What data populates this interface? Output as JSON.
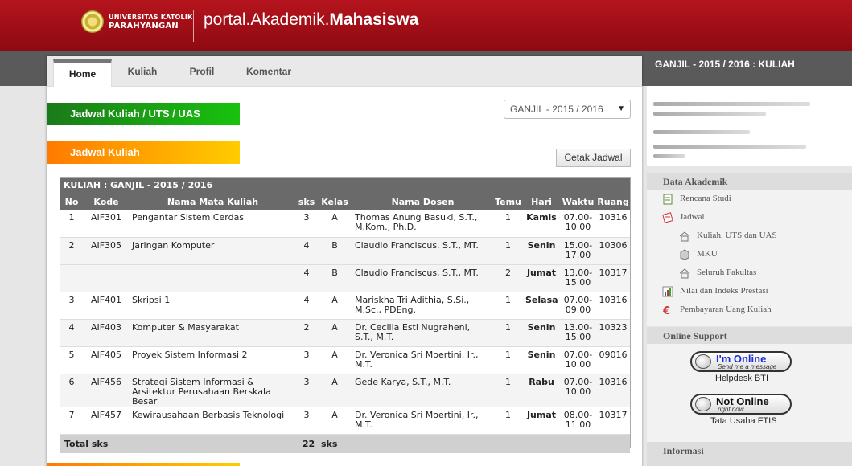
{
  "header": {
    "university_line1": "UNIVERSITAS KATOLIK",
    "university_line2": "PARAHYANGAN",
    "portal_prefix": "portal.Akademik.",
    "portal_suffix": "Mahasiswa"
  },
  "band": {
    "right_text": "GANJIL - 2015 / 2016 : KULIAH"
  },
  "tabs": [
    {
      "label": "Home",
      "active": true
    },
    {
      "label": "Kuliah",
      "active": false
    },
    {
      "label": "Profil",
      "active": false
    },
    {
      "label": "Komentar",
      "active": false
    }
  ],
  "section_titles": {
    "green": "Jadwal Kuliah / UTS / UAS",
    "orange": "Jadwal Kuliah"
  },
  "semester_select": {
    "value": "GANJIL - 2015 / 2016"
  },
  "cetak_button": "Cetak Jadwal",
  "table": {
    "caption": "KULIAH : GANJIL - 2015 / 2016",
    "headers": [
      "No",
      "Kode",
      "Nama Mata Kuliah",
      "sks",
      "Kelas",
      "Nama Dosen",
      "Temu",
      "Hari",
      "Waktu",
      "Ruang"
    ],
    "rows": [
      {
        "no": "1",
        "kode": "AIF301",
        "nama": "Pengantar Sistem Cerdas",
        "sks": "3",
        "kelas": "A",
        "dosen": "Thomas Anung Basuki, S.T., M.Kom., Ph.D.",
        "temu": "1",
        "hari": "Kamis",
        "waktu": "07.00-10.00",
        "ruang": "10316"
      },
      {
        "no": "2",
        "kode": "AIF305",
        "nama": "Jaringan Komputer",
        "sks": "4",
        "kelas": "B",
        "dosen": "Claudio Franciscus, S.T., MT.",
        "temu": "1",
        "hari": "Senin",
        "waktu": "15.00-17.00",
        "ruang": "10306"
      },
      {
        "no": "",
        "kode": "",
        "nama": "",
        "sks": "4",
        "kelas": "B",
        "dosen": "Claudio Franciscus, S.T., MT.",
        "temu": "2",
        "hari": "Jumat",
        "waktu": "13.00-15.00",
        "ruang": "10317"
      },
      {
        "no": "3",
        "kode": "AIF401",
        "nama": "Skripsi 1",
        "sks": "4",
        "kelas": "A",
        "dosen": "Mariskha Tri Adithia, S.Si., M.Sc., PDEng.",
        "temu": "1",
        "hari": "Selasa",
        "waktu": "07.00-09.00",
        "ruang": "10316"
      },
      {
        "no": "4",
        "kode": "AIF403",
        "nama": "Komputer & Masyarakat",
        "sks": "2",
        "kelas": "A",
        "dosen": "Dr. Cecilia Esti Nugraheni, S.T., M.T.",
        "temu": "1",
        "hari": "Senin",
        "waktu": "13.00-15.00",
        "ruang": "10323"
      },
      {
        "no": "5",
        "kode": "AIF405",
        "nama": "Proyek Sistem Informasi 2",
        "sks": "3",
        "kelas": "A",
        "dosen": "Dr. Veronica Sri Moertini, Ir., M.T.",
        "temu": "1",
        "hari": "Senin",
        "waktu": "07.00-10.00",
        "ruang": "09016"
      },
      {
        "no": "6",
        "kode": "AIF456",
        "nama": "Strategi Sistem Informasi & Arsitektur Perusahaan Berskala Besar",
        "sks": "3",
        "kelas": "A",
        "dosen": "Gede Karya, S.T., M.T.",
        "temu": "1",
        "hari": "Rabu",
        "waktu": "07.00-10.00",
        "ruang": "10316"
      },
      {
        "no": "7",
        "kode": "AIF457",
        "nama": "Kewirausahaan Berbasis Teknologi",
        "sks": "3",
        "kelas": "A",
        "dosen": "Dr. Veronica Sri Moertini, Ir., M.T.",
        "temu": "1",
        "hari": "Jumat",
        "waktu": "08.00-11.00",
        "ruang": "10317"
      }
    ],
    "footer": {
      "label": "Total sks",
      "value": "22",
      "unit": "sks"
    }
  },
  "sidebar": {
    "data_akademik_title": "Data Akademik",
    "items": [
      {
        "label": "Rencana Studi",
        "icon": "document-icon"
      },
      {
        "label": "Jadwal",
        "icon": "calendar-icon"
      },
      {
        "label": "Kuliah, UTS dan UAS",
        "icon": "home-icon"
      },
      {
        "label": "MKU",
        "icon": "box-icon"
      },
      {
        "label": "Seluruh Fakultas",
        "icon": "home-icon"
      },
      {
        "label": "Nilai dan Indeks Prestasi",
        "icon": "chart-icon"
      },
      {
        "label": "Pembayaran Uang Kuliah",
        "icon": "euro-icon"
      }
    ],
    "online_support_title": "Online Support",
    "support": [
      {
        "status": "I'm Online",
        "tagline": "Send me a message",
        "caption": "Helpdesk BTI",
        "status_color": "#1a2fd6"
      },
      {
        "status": "Not Online",
        "tagline": "right now",
        "caption": "Tata Usaha FTIS",
        "status_color": "#111111"
      }
    ],
    "informasi_title": "Informasi"
  }
}
